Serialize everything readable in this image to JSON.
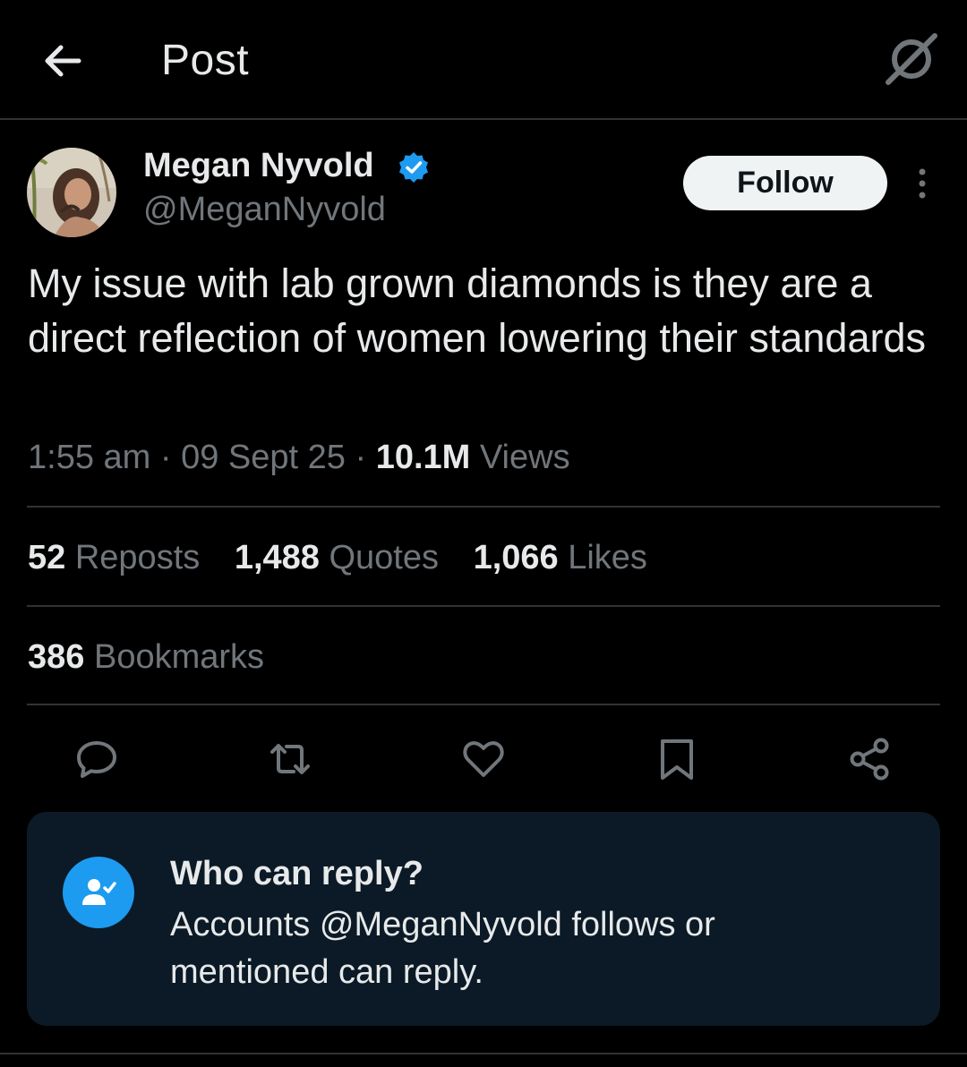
{
  "header": {
    "title": "Post",
    "back_icon": "arrow-left-icon",
    "grok_icon": "grok-icon"
  },
  "author": {
    "display_name": "Megan Nyvold",
    "handle": "@MeganNyvold",
    "verified": true,
    "follow_label": "Follow"
  },
  "tweet": {
    "text": "My issue with lab grown diamonds is they are a direct reflection of women lowering their standards",
    "time": "1:55 am",
    "date": "09 Sept 25",
    "views_count": "10.1M",
    "views_label": "Views"
  },
  "stats": {
    "reposts_count": "52",
    "reposts_label": "Reposts",
    "quotes_count": "1,488",
    "quotes_label": "Quotes",
    "likes_count": "1,066",
    "likes_label": "Likes",
    "bookmarks_count": "386",
    "bookmarks_label": "Bookmarks"
  },
  "actions": [
    "reply-icon",
    "repost-icon",
    "like-icon",
    "bookmark-icon",
    "share-icon"
  ],
  "who_can_reply": {
    "title": "Who can reply?",
    "body": "Accounts @MeganNyvold follows or mentioned can reply."
  },
  "colors": {
    "background": "#000000",
    "text_primary": "#e7e9ea",
    "text_secondary": "#71767b",
    "accent": "#1d9bf0",
    "divider": "#2f3336",
    "card_bg": "#0b1a26"
  }
}
